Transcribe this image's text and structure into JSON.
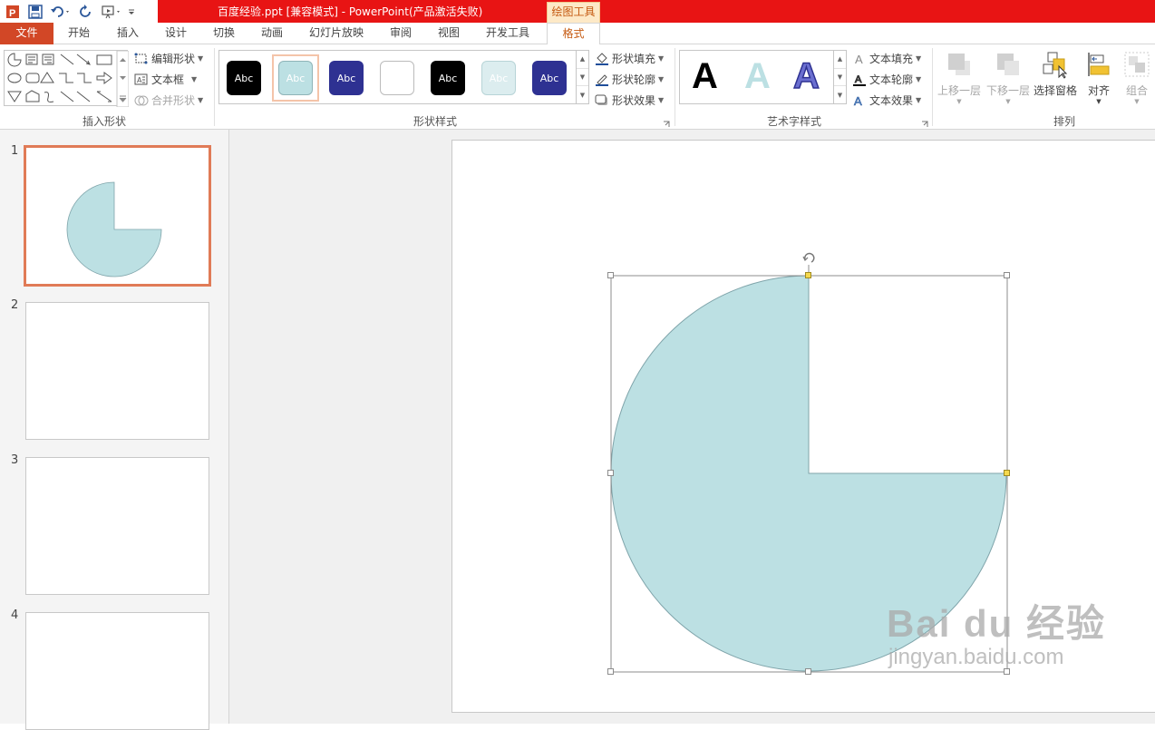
{
  "titlebar": {
    "title": "百度经验.ppt [兼容模式] -  PowerPoint(产品激活失败)",
    "context_tab": "绘图工具"
  },
  "tabs": [
    "文件",
    "开始",
    "插入",
    "设计",
    "切换",
    "动画",
    "幻灯片放映",
    "审阅",
    "视图",
    "开发工具",
    "格式"
  ],
  "ribbon": {
    "insert_shapes": {
      "edit_shape": "编辑形状",
      "text_box": "文本框",
      "merge_shapes": "合并形状",
      "label": "插入形状"
    },
    "shape_styles": {
      "swatches": [
        "Abc",
        "Abc",
        "Abc",
        "Abc",
        "Abc",
        "Abc",
        "Abc",
        "Abc"
      ],
      "shape_fill": "形状填充",
      "shape_outline": "形状轮廓",
      "shape_effects": "形状效果",
      "label": "形状样式"
    },
    "wordart": {
      "letters": [
        "A",
        "A",
        "A"
      ],
      "text_fill": "文本填充",
      "text_outline": "文本轮廓",
      "text_effects": "文本效果",
      "label": "艺术字样式"
    },
    "arrange": {
      "bring_forward": "上移一层",
      "send_backward": "下移一层",
      "selection_pane": "选择窗格",
      "align": "对齐",
      "group": "组合",
      "label": "排列"
    }
  },
  "slides": [
    "1",
    "2",
    "3",
    "4"
  ],
  "shape": {
    "fill": "#bce0e3",
    "outline": "#7fa4aa"
  },
  "accent": {
    "file_tab": "#d24726",
    "title_red": "#e81414",
    "thumb_selected": "#e07b57"
  },
  "watermark": {
    "logo": "Bai du 经验",
    "url": "jingyan.baidu.com"
  }
}
